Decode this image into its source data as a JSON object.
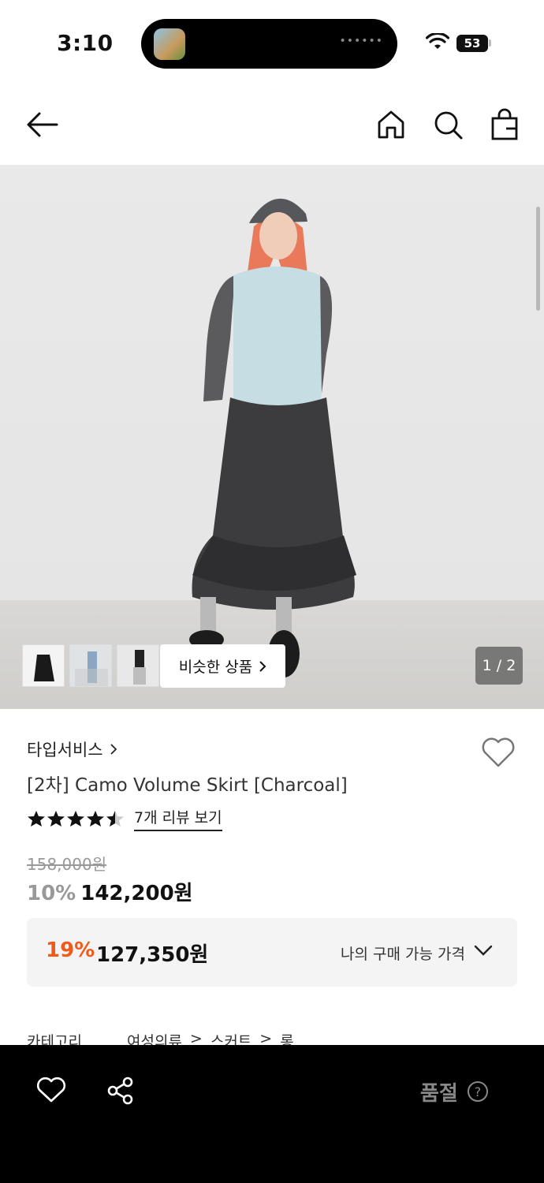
{
  "status_bar": {
    "time": "3:10",
    "battery": "53"
  },
  "gallery": {
    "similar_button": "비슷한 상품",
    "page_indicator": "1 / 2"
  },
  "product": {
    "brand": "타입서비스",
    "title": "[2차] Camo Volume Skirt [Charcoal]",
    "rating": 4.5,
    "review_link": "7개 리뷰 보기",
    "original_price": "158,000원",
    "discount_rate": "10%",
    "sale_price": "142,200원"
  },
  "my_price": {
    "rate": "19%",
    "price": "127,350원",
    "label": "나의 구매 가능 가격"
  },
  "category": {
    "label": "카테고리",
    "path": [
      "여성의류",
      "스커트",
      "롱"
    ]
  },
  "bottom_bar": {
    "status": "품절",
    "help": "?"
  },
  "colors": {
    "accent": "#f05a1a",
    "muted": "#999999",
    "bar": "#000000"
  }
}
